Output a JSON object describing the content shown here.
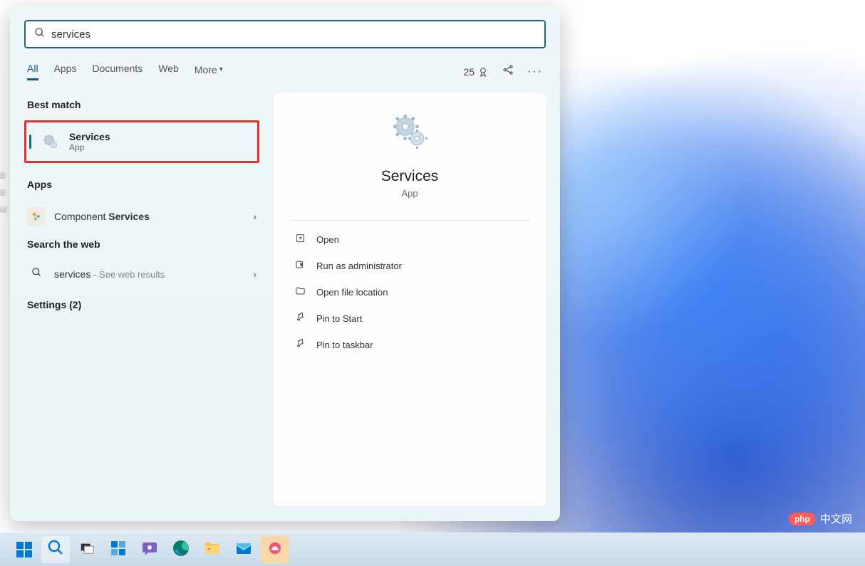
{
  "search": {
    "value": "services"
  },
  "tabs": {
    "items": [
      {
        "label": "All",
        "active": true
      },
      {
        "label": "Apps",
        "active": false
      },
      {
        "label": "Documents",
        "active": false
      },
      {
        "label": "Web",
        "active": false
      }
    ],
    "more": "More"
  },
  "rewards": "25",
  "sections": {
    "best_match": "Best match",
    "apps": "Apps",
    "search_web": "Search the web",
    "settings": "Settings (2)"
  },
  "best_match_item": {
    "title": "Services",
    "subtitle": "App"
  },
  "apps_item": {
    "prefix": "Component ",
    "bold": "Services"
  },
  "web_item": {
    "term": "services",
    "hint": " - See web results"
  },
  "preview": {
    "title": "Services",
    "subtitle": "App",
    "actions": [
      {
        "icon": "open",
        "label": "Open"
      },
      {
        "icon": "shield",
        "label": "Run as administrator"
      },
      {
        "icon": "folder",
        "label": "Open file location"
      },
      {
        "icon": "pin",
        "label": "Pin to Start"
      },
      {
        "icon": "pin",
        "label": "Pin to taskbar"
      }
    ]
  },
  "watermark": {
    "badge": "php",
    "text": "中文网"
  },
  "desktop_labels": [
    "B",
    "B",
    "M"
  ]
}
